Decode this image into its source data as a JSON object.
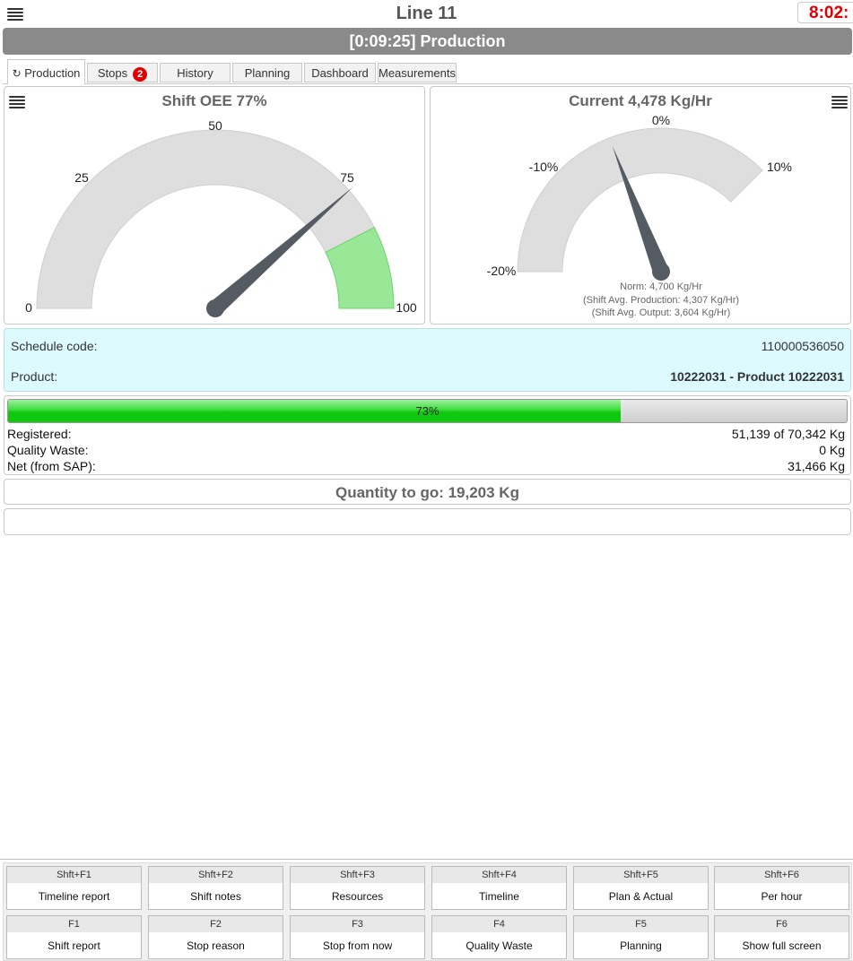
{
  "header": {
    "title": "Line 11",
    "clock": "8:02:"
  },
  "status": {
    "text": "[0:09:25] Production"
  },
  "tabs": [
    {
      "label": "Production",
      "icon": "refresh-icon",
      "active": true
    },
    {
      "label": "Stops",
      "badge": "2"
    },
    {
      "label": "History"
    },
    {
      "label": "Planning"
    },
    {
      "label": "Dashboard"
    },
    {
      "label": "Measurements"
    }
  ],
  "oee_gauge": {
    "title": "Shift OEE 77%",
    "value": 77,
    "min": 0,
    "max": 100,
    "green_from": 85,
    "ticks": [
      "0",
      "25",
      "50",
      "75",
      "100"
    ]
  },
  "rate_gauge": {
    "title": "Current 4,478 Kg/Hr",
    "value_percent": -4.7,
    "min_percent": -20,
    "max_percent": 10,
    "ticks": [
      "-20%",
      "-10%",
      "0%",
      "10%"
    ],
    "norm": "Norm: 4,700 Kg/Hr",
    "avg_production": "(Shift Avg. Production: 4,307 Kg/Hr)",
    "avg_output": "(Shift Avg. Output: 3,604 Kg/Hr)"
  },
  "schedule": {
    "code_label": "Schedule code:",
    "code_value": "110000536050",
    "product_label": "Product:",
    "product_value": "10222031 - Product 10222031"
  },
  "progress": {
    "fraction": 0.73,
    "text": "73%",
    "registered_label": "Registered:",
    "registered_value": "51,139 of 70,342 Kg",
    "waste_label": "Quality Waste:",
    "waste_value": "0 Kg",
    "net_label": "Net (from SAP):",
    "net_value": "31,466 Kg"
  },
  "quantity": {
    "text": "Quantity to go: 19,203 Kg"
  },
  "fkeys": [
    {
      "key": "Shft+F1",
      "label": "Timeline report"
    },
    {
      "key": "Shft+F2",
      "label": "Shift notes"
    },
    {
      "key": "Shft+F3",
      "label": "Resources"
    },
    {
      "key": "Shft+F4",
      "label": "Timeline"
    },
    {
      "key": "Shft+F5",
      "label": "Plan & Actual"
    },
    {
      "key": "Shft+F6",
      "label": "Per hour"
    },
    {
      "key": "F1",
      "label": "Shift report"
    },
    {
      "key": "F2",
      "label": "Stop reason"
    },
    {
      "key": "F3",
      "label": "Stop from now"
    },
    {
      "key": "F4",
      "label": "Quality Waste"
    },
    {
      "key": "F5",
      "label": "Planning"
    },
    {
      "key": "F6",
      "label": "Show full screen"
    }
  ],
  "colors": {
    "accent_red": "#e00000",
    "gauge_gray": "#dedede",
    "gauge_green": "#98e898",
    "needle": "#555b63",
    "info_bg": "#ddfbff"
  }
}
